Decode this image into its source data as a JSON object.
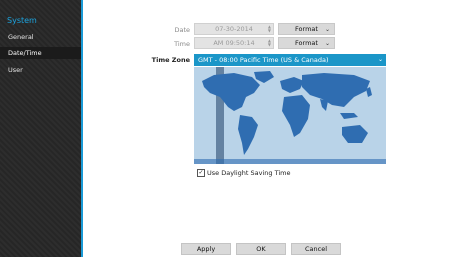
{
  "sidebar": {
    "title": "System",
    "items": [
      {
        "label": "General"
      },
      {
        "label": "Date/Time"
      },
      {
        "label": "User"
      }
    ]
  },
  "date": {
    "label": "Date",
    "value": "07-30-2014",
    "format_label": "Format"
  },
  "time": {
    "label": "Time",
    "value": "AM 09:50:14",
    "format_label": "Format"
  },
  "timezone": {
    "label": "Time Zone",
    "value": "GMT - 08:00  Pacific Time (US & Canada)"
  },
  "dst": {
    "label": "Use Daylight Saving Time",
    "checked": true,
    "check_glyph": "✓"
  },
  "buttons": {
    "apply": "Apply",
    "ok": "OK",
    "cancel": "Cancel"
  },
  "colors": {
    "accent": "#1b96c8",
    "sidebar_bg": "#2a2a2a",
    "map_ocean": "#cfe3f1",
    "map_land": "#2f6db1"
  }
}
